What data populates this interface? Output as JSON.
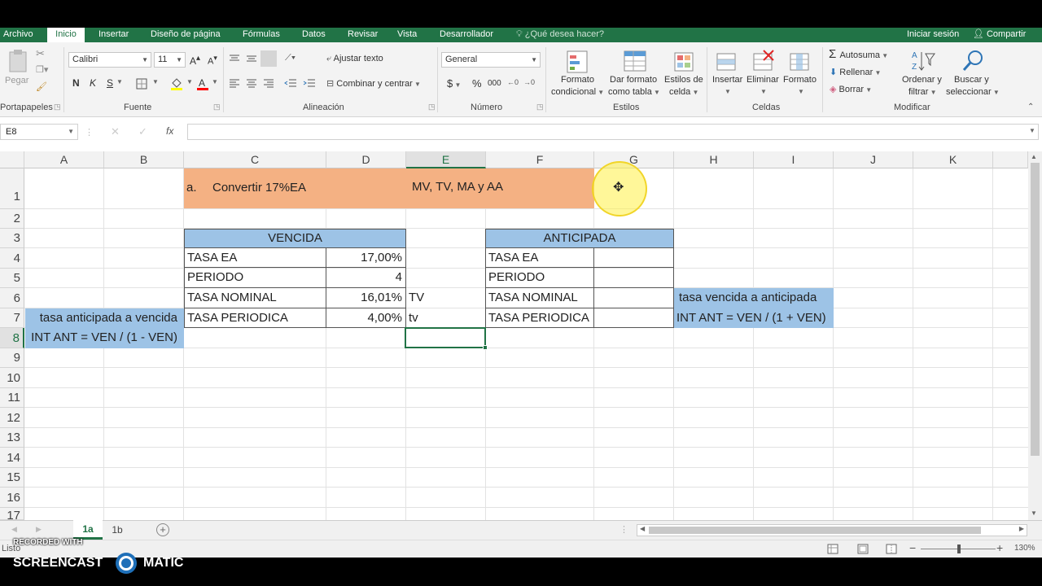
{
  "menu_tabs": [
    "Archivo",
    "Inicio",
    "Insertar",
    "Diseño de página",
    "Fórmulas",
    "Datos",
    "Revisar",
    "Vista",
    "Desarrollador"
  ],
  "tell_me": "¿Qué desea hacer?",
  "account": {
    "signin": "Iniciar sesión",
    "share": "Compartir"
  },
  "ribbon": {
    "portapapeles": {
      "paste": "Pegar",
      "group": "Portapapeles"
    },
    "fuente": {
      "font": "Calibri",
      "size": "11",
      "bold": "N",
      "italic": "K",
      "underline": "S",
      "group": "Fuente"
    },
    "alineacion": {
      "wrap": "Ajustar texto",
      "merge": "Combinar y centrar",
      "group": "Alineación"
    },
    "numero": {
      "format": "General",
      "currency": "$",
      "percent": "%",
      "thousands": "000",
      "group": "Número"
    },
    "estilos": {
      "cond_1": "Formato",
      "cond_2": "condicional",
      "table_1": "Dar formato",
      "table_2": "como tabla",
      "cell_1": "Estilos de",
      "cell_2": "celda",
      "group": "Estilos"
    },
    "celdas": {
      "insert": "Insertar",
      "delete": "Eliminar",
      "format": "Formato",
      "group": "Celdas"
    },
    "modificar": {
      "autosum": "Autosuma",
      "fill": "Rellenar",
      "clear": "Borrar",
      "sort_1": "Ordenar y",
      "sort_2": "filtrar",
      "find_1": "Buscar y",
      "find_2": "seleccionar",
      "group": "Modificar"
    }
  },
  "formula_bar": {
    "name_box": "E8",
    "fx": "fx",
    "content": ""
  },
  "columns": [
    "A",
    "B",
    "C",
    "D",
    "E",
    "F",
    "G",
    "H",
    "I",
    "J",
    "K"
  ],
  "rows": [
    "1",
    "2",
    "3",
    "4",
    "5",
    "6",
    "7",
    "8",
    "9",
    "10",
    "11",
    "12",
    "13",
    "14",
    "15",
    "16",
    "17"
  ],
  "cells": {
    "title_a": "a.",
    "title_text": "Convertir 17%EA",
    "title_targets": "MV, TV, MA y AA",
    "vencida_header": "VENCIDA",
    "vencida_rows": [
      {
        "label": "TASA EA",
        "value": "17,00%",
        "note": ""
      },
      {
        "label": "PERIODO",
        "value": "4",
        "note": ""
      },
      {
        "label": "TASA NOMINAL",
        "value": "16,01%",
        "note": "TV"
      },
      {
        "label": "TASA PERIODICA",
        "value": "4,00%",
        "note": "tv"
      }
    ],
    "anticipada_header": "ANTICIPADA",
    "anticipada_rows": [
      {
        "label": "TASA EA",
        "value": ""
      },
      {
        "label": "PERIODO",
        "value": ""
      },
      {
        "label": "TASA NOMINAL",
        "value": ""
      },
      {
        "label": "TASA PERIODICA",
        "value": ""
      }
    ],
    "note_left_1": "tasa anticipada a vencida",
    "note_left_2": "INT ANT = VEN / (1 - VEN)",
    "note_right_1": "tasa vencida a anticipada",
    "note_right_2": "INT ANT = VEN / (1 + VEN)"
  },
  "sheets": [
    "1a",
    "1b"
  ],
  "active_sheet": "1a",
  "status": {
    "ready": "Listo",
    "zoom": "130%"
  },
  "watermark": {
    "line1": "RECORDED WITH",
    "line2": "SCREENCAST",
    "line3": "MATIC"
  },
  "colors": {
    "excel_green": "#217346",
    "title_fill": "#f4b183",
    "header_fill": "#9dc3e6"
  }
}
